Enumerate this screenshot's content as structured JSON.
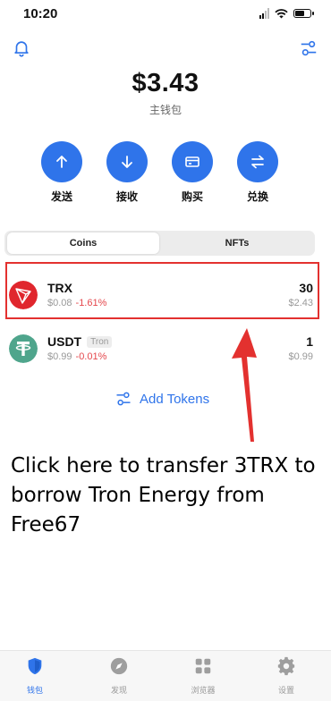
{
  "status_bar": {
    "time": "10:20"
  },
  "wallet": {
    "balance": "$3.43",
    "name": "主钱包"
  },
  "actions": [
    {
      "label": "发送",
      "icon": "arrow-up-icon"
    },
    {
      "label": "接收",
      "icon": "arrow-down-icon"
    },
    {
      "label": "购买",
      "icon": "card-icon"
    },
    {
      "label": "兑换",
      "icon": "swap-icon"
    }
  ],
  "tabs": {
    "coins": "Coins",
    "nfts": "NFTs",
    "active": "Coins"
  },
  "tokens": [
    {
      "symbol": "TRX",
      "price": "$0.08",
      "change": "-1.61%",
      "amount": "30",
      "value": "$2.43",
      "icon": "tron-logo-icon"
    },
    {
      "symbol": "USDT",
      "network_badge": "Tron",
      "price": "$0.99",
      "change": "-0.01%",
      "amount": "1",
      "value": "$0.99",
      "icon": "tether-logo-icon"
    }
  ],
  "add_tokens": "Add Tokens",
  "annotation": "Click here to transfer 3TRX to borrow Tron Energy from Free67",
  "bottom_nav": [
    {
      "label": "钱包",
      "icon": "wallet-shield-icon",
      "active": true
    },
    {
      "label": "发现",
      "icon": "compass-icon",
      "active": false
    },
    {
      "label": "浏览器",
      "icon": "grid-icon",
      "active": false
    },
    {
      "label": "设置",
      "icon": "gear-icon",
      "active": false
    }
  ],
  "colors": {
    "accent": "#2f74ea",
    "negative": "#e5484d",
    "highlight": "#e3312f",
    "trx": "#e0262d",
    "usdt": "#4fa58c"
  }
}
